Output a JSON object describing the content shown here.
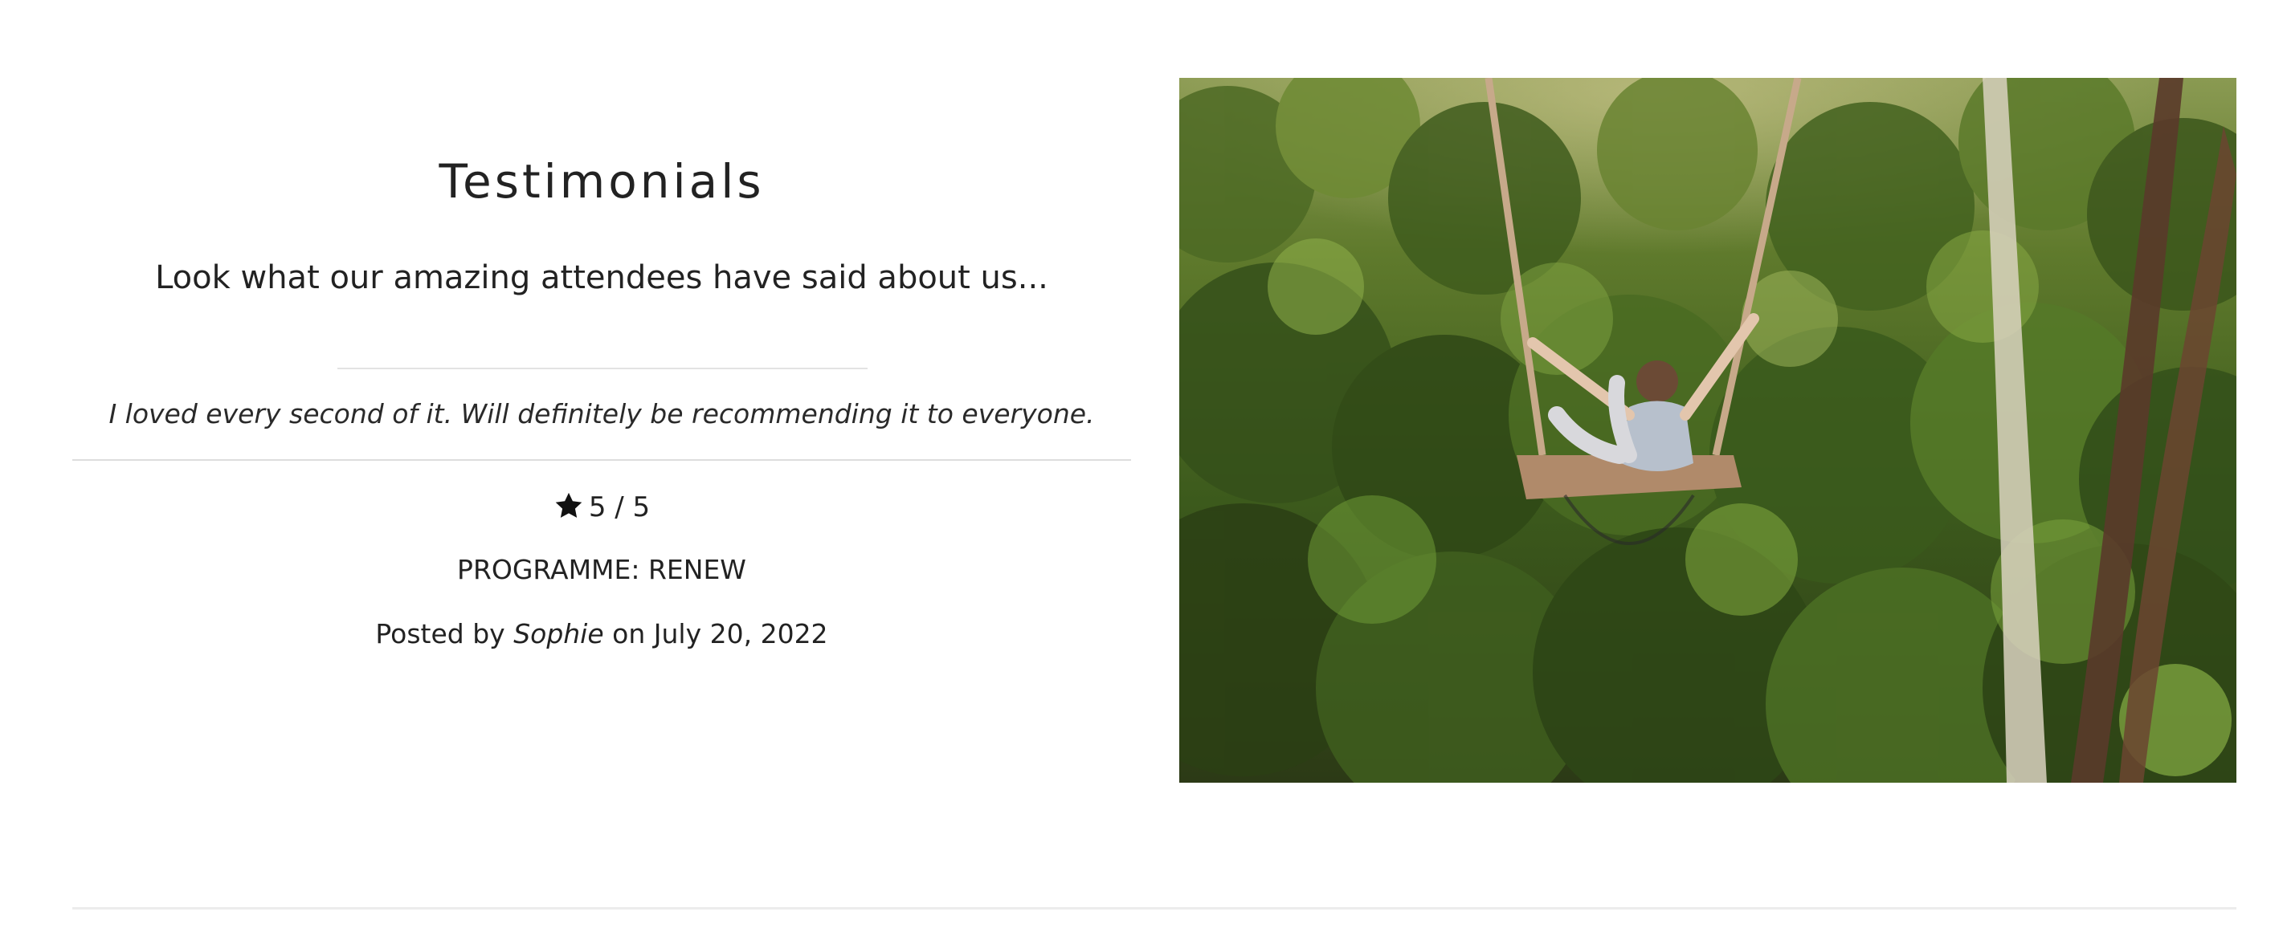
{
  "section": {
    "title": "Testimonials",
    "subtitle": "Look what our amazing attendees have said about us..."
  },
  "testimonial": {
    "quote": "I loved every second of it. Will definitely be recommending it to everyone.",
    "rating_text": "5 / 5",
    "rating_value": 5,
    "rating_max": 5,
    "programme": "PROGRAMME: RENEW",
    "posted_prefix": "Posted by",
    "author": "Sophie",
    "posted_on": "on July 20, 2022"
  },
  "photo": {
    "subject": "woman-on-jungle-swing"
  },
  "icons": {
    "rating": "star-icon"
  },
  "colors": {
    "text": "#222222",
    "divider": "#dddddd",
    "foliage_dark": "#2e3d17",
    "foliage_mid": "#5b7a2a",
    "foliage_light": "#9cb45a"
  }
}
